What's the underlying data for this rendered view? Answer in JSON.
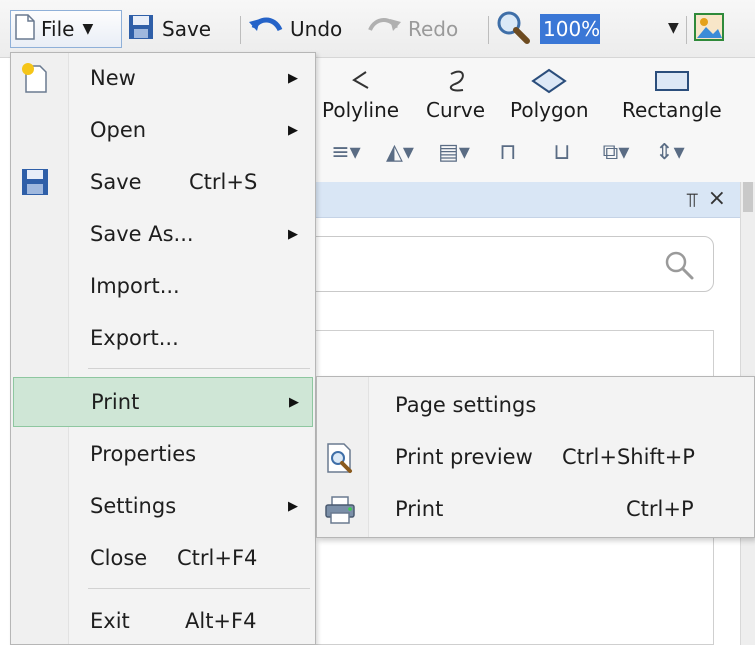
{
  "toolbar": {
    "file_label": "File",
    "save_label": "Save",
    "undo_label": "Undo",
    "redo_label": "Redo",
    "zoom_value": "100%",
    "icons": [
      "new-document-icon",
      "floppy-disk-icon",
      "undo-icon",
      "redo-icon",
      "zoom-icon",
      "image-icon"
    ]
  },
  "ribbon": {
    "shapes": [
      {
        "label": "Polyline",
        "icon": "polyline-icon"
      },
      {
        "label": "Curve",
        "icon": "curve-icon"
      },
      {
        "label": "Polygon",
        "icon": "polygon-icon"
      },
      {
        "label": "Rectangle",
        "icon": "rectangle-icon"
      }
    ]
  },
  "panel": {
    "pin_glyph": "⫪",
    "close_glyph": "×"
  },
  "file_menu": {
    "items": [
      {
        "label": "New",
        "shortcut": "",
        "submenu": true,
        "icon": "new-document-icon"
      },
      {
        "label": "Open",
        "shortcut": "",
        "submenu": true,
        "icon": ""
      },
      {
        "label": "Save",
        "shortcut": "Ctrl+S",
        "submenu": false,
        "icon": "floppy-disk-icon"
      },
      {
        "label": "Save As...",
        "shortcut": "",
        "submenu": true,
        "icon": ""
      },
      {
        "label": "Import...",
        "shortcut": "",
        "submenu": false,
        "icon": ""
      },
      {
        "label": "Export...",
        "shortcut": "",
        "submenu": false,
        "icon": ""
      },
      {
        "label": "Print",
        "shortcut": "",
        "submenu": true,
        "icon": "",
        "active": true
      },
      {
        "label": "Properties",
        "shortcut": "",
        "submenu": false,
        "icon": ""
      },
      {
        "label": "Settings",
        "shortcut": "",
        "submenu": true,
        "icon": ""
      },
      {
        "label": "Close",
        "shortcut": "Ctrl+F4",
        "submenu": false,
        "icon": ""
      },
      {
        "label": "Exit",
        "shortcut": "Alt+F4",
        "submenu": false,
        "icon": ""
      }
    ]
  },
  "print_submenu": {
    "items": [
      {
        "label": "Page settings",
        "shortcut": "",
        "icon": ""
      },
      {
        "label": "Print preview",
        "shortcut": "Ctrl+Shift+P",
        "icon": "print-preview-icon"
      },
      {
        "label": "Print",
        "shortcut": "Ctrl+P",
        "icon": "printer-icon"
      }
    ]
  },
  "colors": {
    "active_item_bg": "#cfe6d6",
    "active_item_border": "#8ec7a0",
    "zoom_selection": "#3a77d6",
    "panel_header": "#d9e6f5"
  }
}
